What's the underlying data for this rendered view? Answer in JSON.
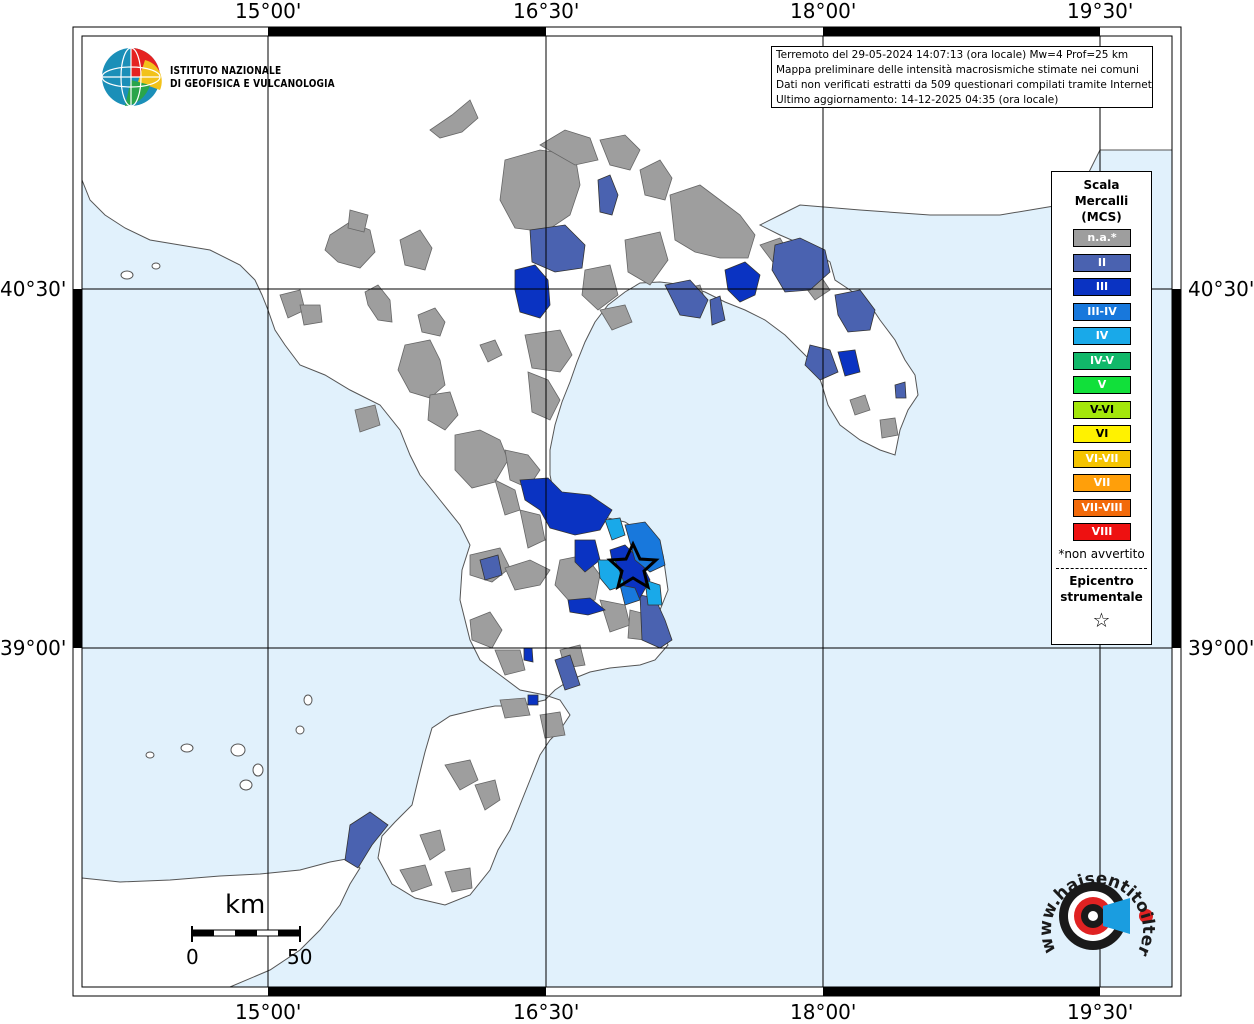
{
  "coords": {
    "top": [
      "15°00'",
      "16°30'",
      "18°00'",
      "19°30'"
    ],
    "bottom": [
      "15°00'",
      "16°30'",
      "18°00'",
      "19°30'"
    ],
    "left": [
      "40°30'",
      "39°00'"
    ],
    "right": [
      "40°30'",
      "39°00'"
    ]
  },
  "logo": {
    "line1": "ISTITUTO NAZIONALE",
    "line2": "DI GEOFISICA E VULCANOLOGIA"
  },
  "info": {
    "line1": "Terremoto del 29-05-2024 14:07:13 (ora locale) Mw=4 Prof=25 km",
    "line2": "Mappa preliminare delle intensità macrosismiche stimate nei comuni",
    "line3": "Dati non verificati estratti da 509 questionari compilati tramite Internet.",
    "line4": "Ultimo aggiornamento: 14-12-2025 04:35 (ora locale)"
  },
  "legend": {
    "title1": "Scala",
    "title2": "Mercalli",
    "title3": "(MCS)",
    "items": [
      {
        "label": "n.a.*",
        "color": "#9e9e9e"
      },
      {
        "label": "II",
        "color": "#4a62b0"
      },
      {
        "label": "III",
        "color": "#0a33c2"
      },
      {
        "label": "III-IV",
        "color": "#1878dc"
      },
      {
        "label": "IV",
        "color": "#19a9e9"
      },
      {
        "label": "IV-V",
        "color": "#11b86a"
      },
      {
        "label": "V",
        "color": "#11e03a"
      },
      {
        "label": "V-VI",
        "color": "#a3e60b"
      },
      {
        "label": "VI",
        "color": "#fff200"
      },
      {
        "label": "VI-VII",
        "color": "#f5c400"
      },
      {
        "label": "VII",
        "color": "#ff9f0a"
      },
      {
        "label": "VII-VIII",
        "color": "#f26a0a"
      },
      {
        "label": "VIII",
        "color": "#ee1111"
      }
    ],
    "note": "*non avvertito",
    "epicenter1": "Epicentro",
    "epicenter2": "strumentale",
    "star": "☆"
  },
  "scale": {
    "unit": "km",
    "min": "0",
    "max": "50"
  },
  "colors": {
    "sea": "#e1f1fc",
    "land": "#ffffff",
    "grid": "#000000",
    "na": "#9e9e9e",
    "II": "#4a62b0",
    "III": "#0a33c2",
    "III-IV": "#1878dc",
    "IV": "#19a9e9"
  },
  "hsit_logo": {
    "text": "www.haisentitoilterremoto.it",
    "icon": "speaker-target-icon"
  }
}
